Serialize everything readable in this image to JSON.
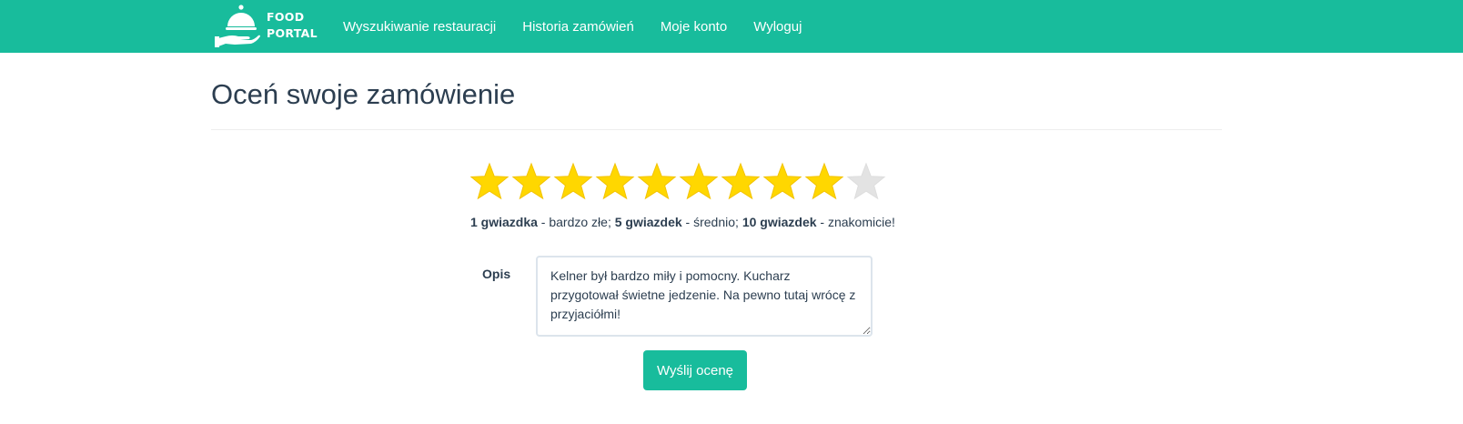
{
  "brand": {
    "line1": "FOOD",
    "line2": "PORTAL",
    "icon": "cloche-icon"
  },
  "nav": [
    {
      "label": "Wyszukiwanie restauracji"
    },
    {
      "label": "Historia zamówień"
    },
    {
      "label": "Moje konto"
    },
    {
      "label": "Wyloguj"
    }
  ],
  "page": {
    "title": "Oceń swoje zamówienie"
  },
  "rating": {
    "value": 9,
    "max": 10,
    "filled_color": "#ffd700",
    "empty_color": "#e3e3e3",
    "icon": "star-icon"
  },
  "legend": {
    "part1_bold": "1 gwiazdka",
    "part1_text": " - bardzo złe; ",
    "part2_bold": "5 gwiazdek",
    "part2_text": " - średnio; ",
    "part3_bold": "10 gwiazdek",
    "part3_text": " - znakomicie!"
  },
  "form": {
    "description_label": "Opis",
    "description_value": "Kelner był bardzo miły i pomocny. Kucharz przygotował świetne jedzenie. Na pewno tutaj wrócę z przyjaciółmi!",
    "submit_label": "Wyślij ocenę"
  },
  "colors": {
    "accent": "#18bc9c",
    "text": "#2c3e50"
  }
}
